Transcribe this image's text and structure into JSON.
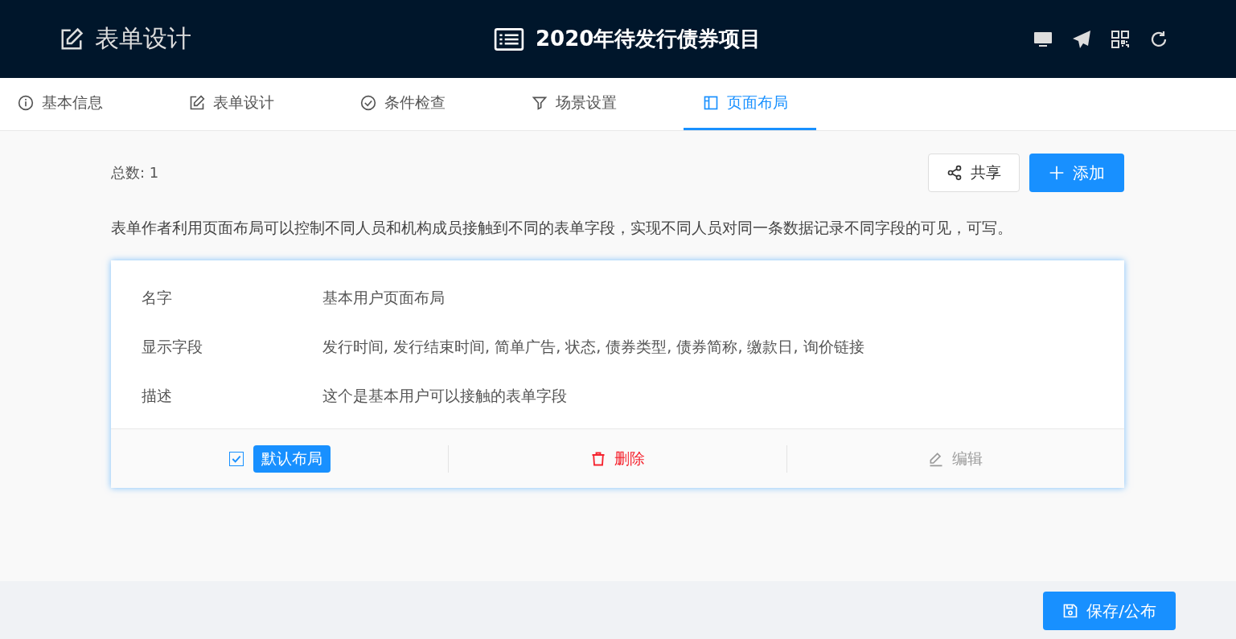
{
  "header": {
    "title": "表单设计",
    "project_title": "2020年待发行债券项目"
  },
  "tabs": [
    {
      "label": "基本信息",
      "selected": false
    },
    {
      "label": "表单设计",
      "selected": false
    },
    {
      "label": "条件检查",
      "selected": false
    },
    {
      "label": "场景设置",
      "selected": false
    },
    {
      "label": "页面布局",
      "selected": true
    }
  ],
  "total": "总数: 1",
  "share_button": "共享",
  "add_button": "添加",
  "description": "表单作者利用页面布局可以控制不同人员和机构成员接触到不同的表单字段，实现不同人员对同一条数据记录不同字段的可见，可写。",
  "layout_card": {
    "fields": [
      {
        "label": "名字",
        "value": "基本用户页面布局"
      },
      {
        "label": "显示字段",
        "value": "发行时间, 发行结束时间, 简单广告, 状态, 债券类型, 债券简称, 缴款日, 询价链接"
      },
      {
        "label": "描述",
        "value": "这个是基本用户可以接触的表单字段"
      }
    ],
    "default_checked": true,
    "default_label": "默认布局",
    "delete_label": "删除",
    "edit_label": "编辑"
  },
  "save_button": "保存/公布"
}
